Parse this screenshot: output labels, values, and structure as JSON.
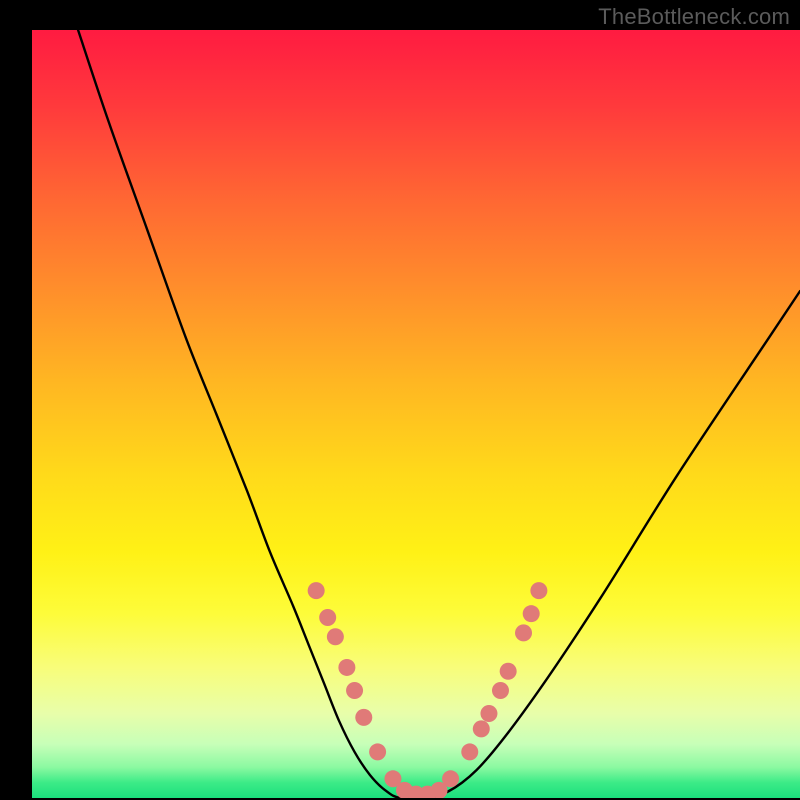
{
  "watermark": "TheBottleneck.com",
  "chart_data": {
    "type": "line",
    "title": "",
    "xlabel": "",
    "ylabel": "",
    "xlim": [
      0,
      100
    ],
    "ylim": [
      0,
      100
    ],
    "series": [
      {
        "name": "bottleneck-curve",
        "x": [
          6,
          10,
          15,
          20,
          24,
          28,
          31,
          34,
          36,
          38,
          40,
          42,
          44,
          46,
          48,
          52,
          56,
          60,
          66,
          74,
          84,
          96,
          100
        ],
        "y": [
          100,
          88,
          74,
          60,
          50,
          40,
          32,
          25,
          20,
          15,
          10,
          6,
          3,
          1,
          0,
          0,
          2,
          6,
          14,
          26,
          42,
          60,
          66
        ]
      }
    ],
    "markers": {
      "name": "highlight-dots",
      "color": "#e07a78",
      "points": [
        {
          "x": 37.0,
          "y": 27.0
        },
        {
          "x": 38.5,
          "y": 23.5
        },
        {
          "x": 39.5,
          "y": 21.0
        },
        {
          "x": 41.0,
          "y": 17.0
        },
        {
          "x": 42.0,
          "y": 14.0
        },
        {
          "x": 43.2,
          "y": 10.5
        },
        {
          "x": 45.0,
          "y": 6.0
        },
        {
          "x": 47.0,
          "y": 2.5
        },
        {
          "x": 48.5,
          "y": 1.0
        },
        {
          "x": 50.0,
          "y": 0.5
        },
        {
          "x": 51.5,
          "y": 0.5
        },
        {
          "x": 53.0,
          "y": 1.0
        },
        {
          "x": 54.5,
          "y": 2.5
        },
        {
          "x": 57.0,
          "y": 6.0
        },
        {
          "x": 58.5,
          "y": 9.0
        },
        {
          "x": 59.5,
          "y": 11.0
        },
        {
          "x": 61.0,
          "y": 14.0
        },
        {
          "x": 62.0,
          "y": 16.5
        },
        {
          "x": 64.0,
          "y": 21.5
        },
        {
          "x": 65.0,
          "y": 24.0
        },
        {
          "x": 66.0,
          "y": 27.0
        }
      ]
    },
    "gradient_colors": {
      "top": "#ff1b41",
      "mid": "#fff116",
      "bottom": "#1bdf7d"
    }
  }
}
